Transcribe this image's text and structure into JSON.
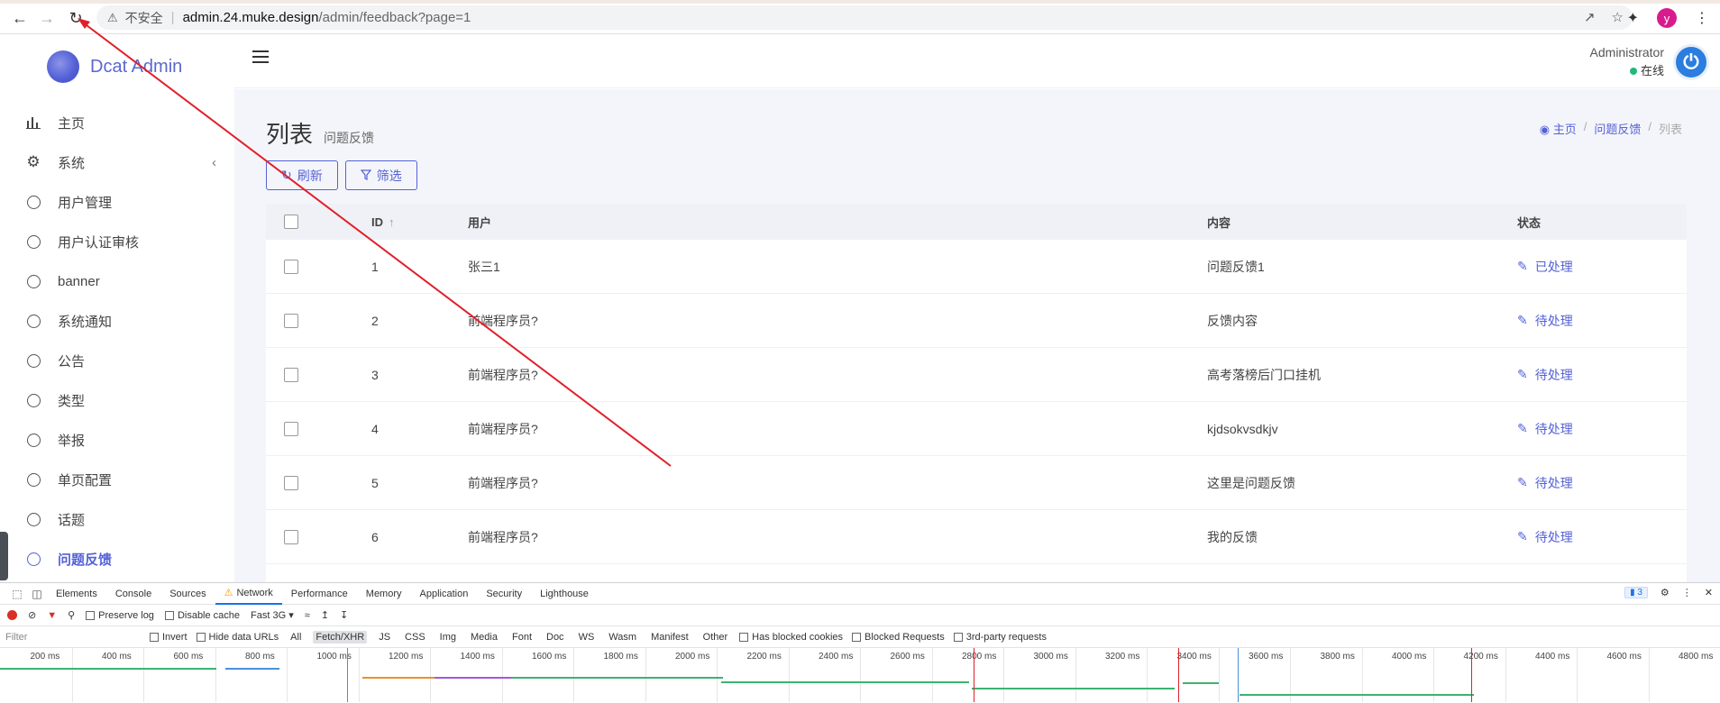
{
  "browser": {
    "insecure_label": "不安全",
    "url_host": "admin.24.muke.design",
    "url_path": "/admin/feedback?page=1",
    "profile_initial": "y"
  },
  "app": {
    "brand": "Dcat Admin"
  },
  "sidebar": {
    "items": [
      {
        "label": "主页",
        "icon": "bar-chart-icon"
      },
      {
        "label": "系统",
        "icon": "gear-icon"
      },
      {
        "label": "用户管理",
        "icon": "circle-icon"
      },
      {
        "label": "用户认证审核",
        "icon": "circle-icon"
      },
      {
        "label": "banner",
        "icon": "circle-icon"
      },
      {
        "label": "系统通知",
        "icon": "circle-icon"
      },
      {
        "label": "公告",
        "icon": "circle-icon"
      },
      {
        "label": "类型",
        "icon": "circle-icon"
      },
      {
        "label": "举报",
        "icon": "circle-icon"
      },
      {
        "label": "单页配置",
        "icon": "circle-icon"
      },
      {
        "label": "话题",
        "icon": "circle-icon"
      },
      {
        "label": "问题反馈",
        "icon": "circle-icon",
        "active": true
      }
    ]
  },
  "header": {
    "user_name": "Administrator",
    "user_status": "在线"
  },
  "page": {
    "title": "列表",
    "subtitle": "问题反馈",
    "breadcrumb": [
      "主页",
      "问题反馈",
      "列表"
    ],
    "refresh_label": "刷新",
    "filter_label": "筛选"
  },
  "table": {
    "headers": [
      "ID",
      "用户",
      "内容",
      "状态"
    ],
    "rows": [
      {
        "id": "1",
        "user": "张三1",
        "content": "问题反馈1",
        "status": "已处理"
      },
      {
        "id": "2",
        "user": "前端程序员?",
        "content": "反馈内容",
        "status": "待处理"
      },
      {
        "id": "3",
        "user": "前端程序员?",
        "content": "高考落榜后门口挂机",
        "status": "待处理"
      },
      {
        "id": "4",
        "user": "前端程序员?",
        "content": "kjdsokvsdkjv",
        "status": "待处理"
      },
      {
        "id": "5",
        "user": "前端程序员?",
        "content": "这里是问题反馈",
        "status": "待处理"
      },
      {
        "id": "6",
        "user": "前端程序员?",
        "content": "我的反馈",
        "status": "待处理"
      }
    ]
  },
  "devtools": {
    "tabs": [
      "Elements",
      "Console",
      "Sources",
      "Network",
      "Performance",
      "Memory",
      "Application",
      "Security",
      "Lighthouse"
    ],
    "active_tab": "Network",
    "issues_count": "3",
    "preserve_log": "Preserve log",
    "disable_cache": "Disable cache",
    "throttling": "Fast 3G",
    "filter_placeholder": "Filter",
    "invert": "Invert",
    "hide_data_urls": "Hide data URLs",
    "types": [
      "All",
      "Fetch/XHR",
      "JS",
      "CSS",
      "Img",
      "Media",
      "Font",
      "Doc",
      "WS",
      "Wasm",
      "Manifest",
      "Other"
    ],
    "active_type": "Fetch/XHR",
    "has_blocked_cookies": "Has blocked cookies",
    "blocked_requests": "Blocked Requests",
    "third_party": "3rd-party requests",
    "ticks": [
      "200 ms",
      "400 ms",
      "600 ms",
      "800 ms",
      "1000 ms",
      "1200 ms",
      "1400 ms",
      "1600 ms",
      "1800 ms",
      "2000 ms",
      "2200 ms",
      "2400 ms",
      "2600 ms",
      "2800 ms",
      "3000 ms",
      "3200 ms",
      "3400 ms",
      "3600 ms",
      "3800 ms",
      "4000 ms",
      "4200 ms",
      "4400 ms",
      "4600 ms",
      "4800 ms"
    ]
  },
  "colors": {
    "accent": "#5461d6",
    "online": "#21b978",
    "annotation": "#e0202a"
  }
}
